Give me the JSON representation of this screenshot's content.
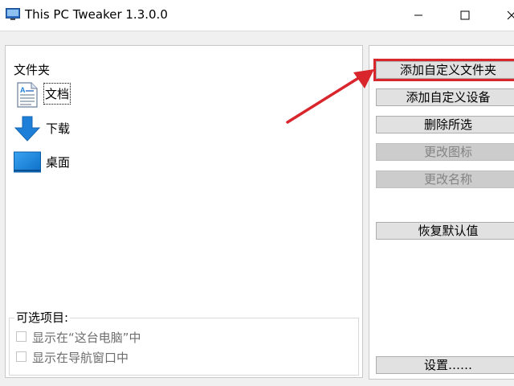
{
  "window": {
    "title": "This PC Tweaker 1.3.0.0",
    "controls": [
      "minimize-icon",
      "maximize-icon",
      "close-icon"
    ]
  },
  "folders": {
    "label": "文件夹",
    "items": [
      {
        "label": "文档",
        "icon": "document-icon",
        "selected": true
      },
      {
        "label": "下载",
        "icon": "download-arrow-icon",
        "selected": false
      },
      {
        "label": "桌面",
        "icon": "desktop-icon",
        "selected": false
      }
    ]
  },
  "options": {
    "legend": "可选项目:",
    "items": [
      {
        "label": "显示在“这台电脑”中",
        "checked": false
      },
      {
        "label": "显示在导航窗口中",
        "checked": false
      }
    ]
  },
  "actions": {
    "add_folder": "添加自定义文件夹",
    "add_device": "添加自定义设备",
    "delete_selected": "删除所选",
    "change_icon": "更改图标",
    "change_name": "更改名称",
    "restore_default": "恢复默认值",
    "settings": "设置……"
  },
  "colors": {
    "annotation": "#d8262c",
    "icon_blue": "#1e7fd8"
  }
}
